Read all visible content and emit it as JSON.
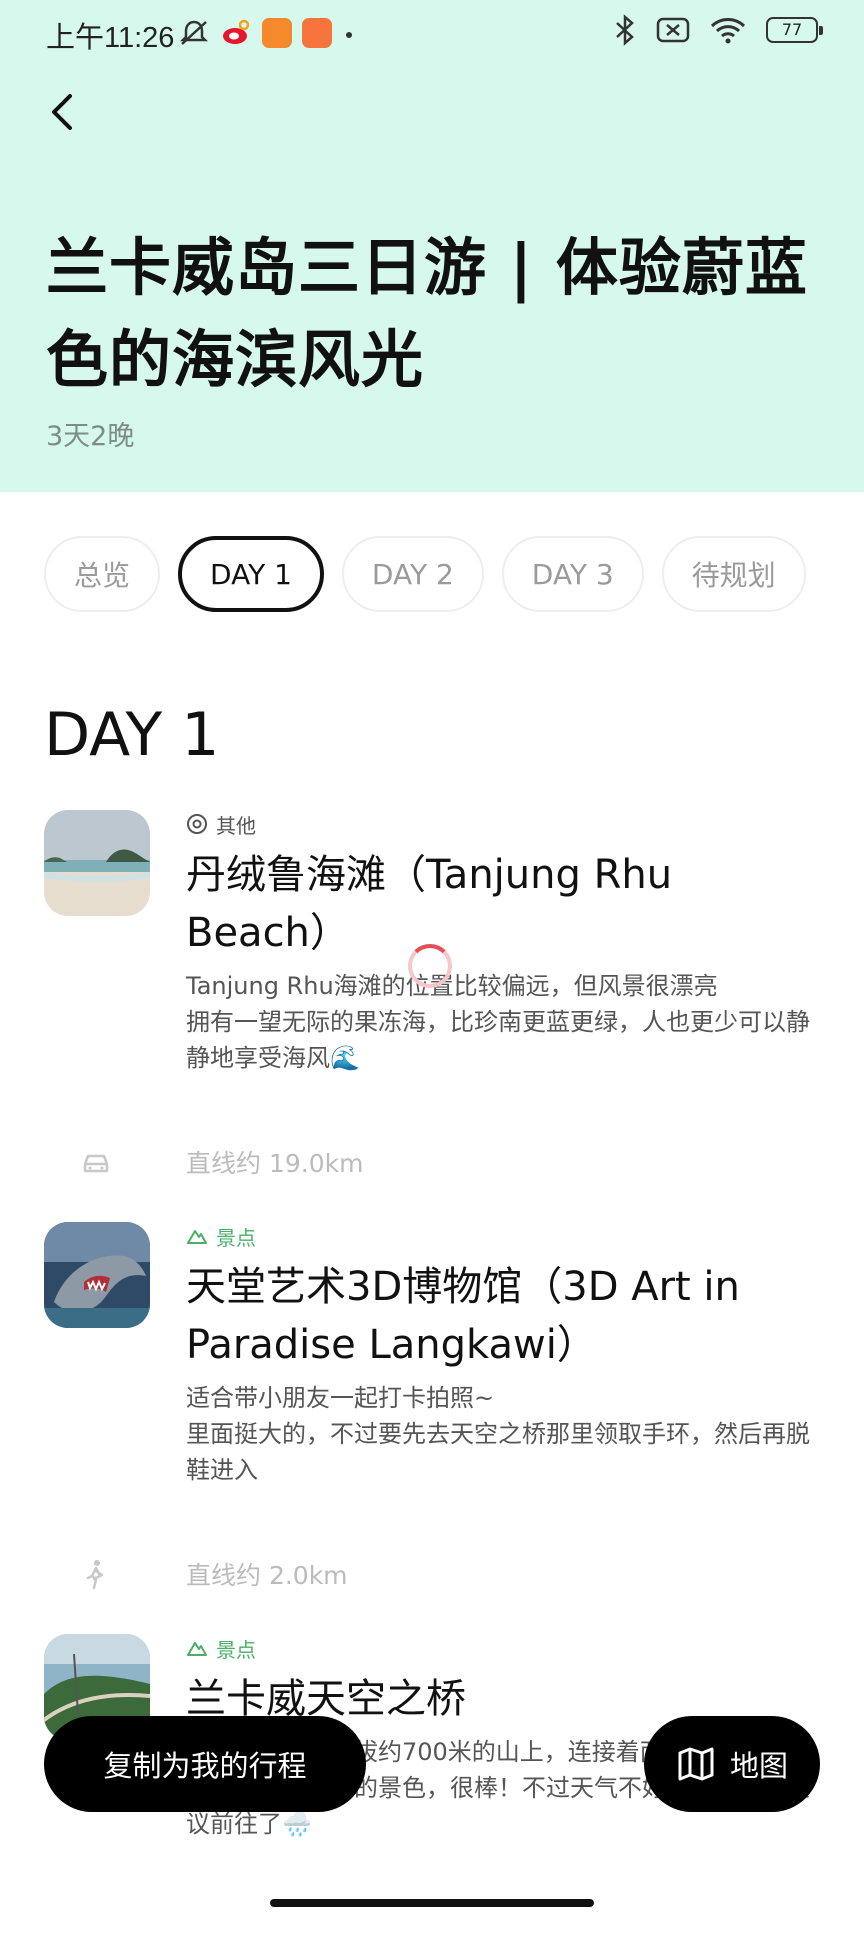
{
  "status_bar": {
    "time": "上午11:26",
    "battery": "77",
    "icons": [
      "mute-icon",
      "weibo-icon",
      "app-icon",
      "app-icon",
      "dot-icon",
      "bluetooth-icon",
      "sim-icon",
      "wifi-icon",
      "battery-icon"
    ]
  },
  "header": {
    "title": "兰卡威岛三日游 | 体验蔚蓝色的海滨风光",
    "duration": "3天2晚",
    "background": "#d7f8ec"
  },
  "tabs": [
    {
      "label": "总览",
      "active": false
    },
    {
      "label": "DAY 1",
      "active": true
    },
    {
      "label": "DAY 2",
      "active": false
    },
    {
      "label": "DAY 3",
      "active": false
    },
    {
      "label": "待规划",
      "active": false
    }
  ],
  "day_heading": "DAY 1",
  "places": [
    {
      "category": "其他",
      "name": "丹绒鲁海滩（Tanjung Rhu Beach）",
      "description": "Tanjung Rhu海滩的位置比较偏远，但风景很漂亮\n拥有一望无际的果冻海，比珍南更蓝更绿，人也更少可以静静地享受海风🌊"
    },
    {
      "category": "景点",
      "name": "天堂艺术3D博物馆（3D Art in Paradise Langkawi）",
      "description": "适合带小朋友一起打卡拍照~\n里面挺大的，不过要先去天空之桥那里领取手环，然后再脱鞋进入"
    },
    {
      "category": "景点",
      "name": "兰卡威天空之桥",
      "description": "天空之桥位于海拔约700米的山上，连接着两个山头，可以俯瞰整个兰卡威的景色，很棒！不过天气不好的情况就不建议前往了🌧️"
    }
  ],
  "transits": [
    {
      "mode": "car",
      "text": "直线约 19.0km"
    },
    {
      "mode": "walk",
      "text": "直线约 2.0km"
    }
  ],
  "actions": {
    "copy_label": "复制为我的行程",
    "map_label": "地图"
  },
  "colors": {
    "accent_green": "#4cae6a",
    "spinner": "#e64d56"
  }
}
